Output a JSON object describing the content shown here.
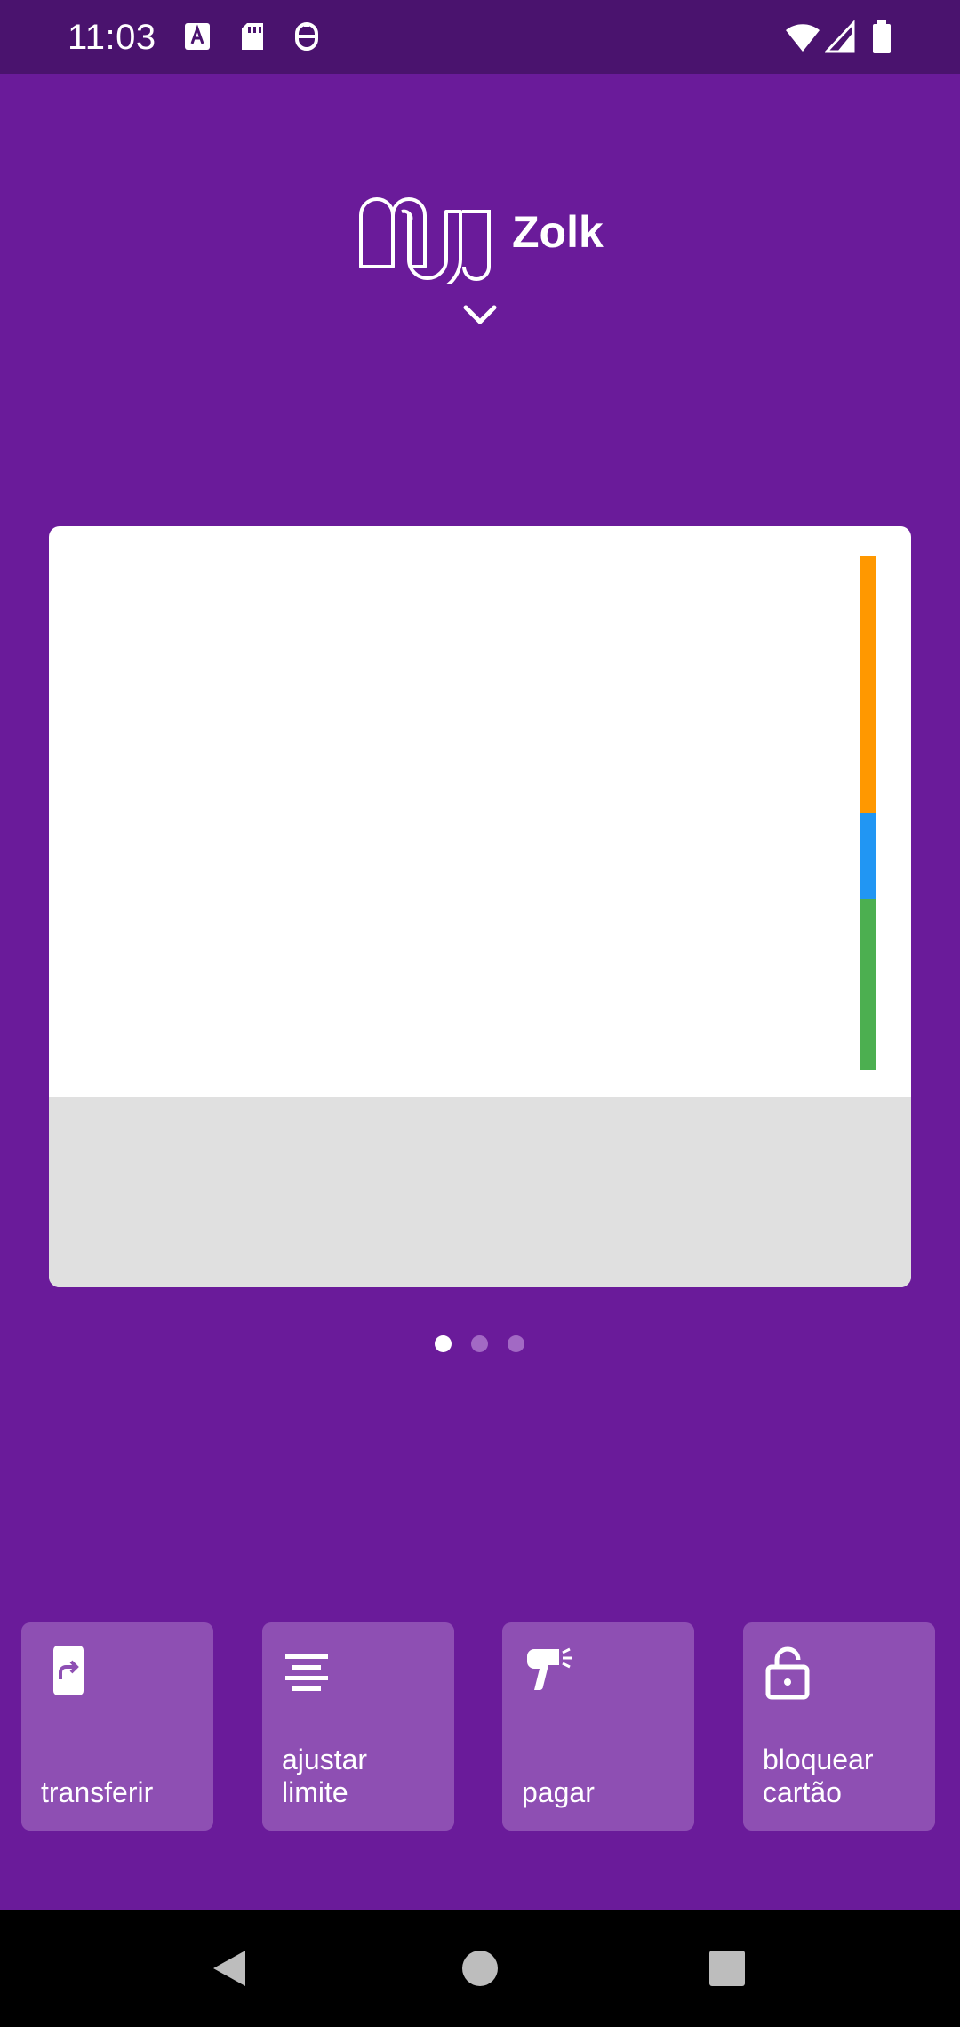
{
  "status_bar": {
    "time": "11:03",
    "left_icons": [
      "a-icon",
      "sd-card-icon",
      "vpn-icon"
    ],
    "right_icons": [
      "wifi-icon",
      "signal-icon",
      "battery-icon"
    ]
  },
  "header": {
    "logo": "nu-logo",
    "user_name": "Zolk",
    "expand_icon": "chevron-down-icon"
  },
  "card": {
    "indicator_bar": [
      {
        "color": "#FF9800",
        "share": 0.5
      },
      {
        "color": "#2196F3",
        "share": 0.167
      },
      {
        "color": "#4CAF50",
        "share": 0.333
      }
    ]
  },
  "pager": {
    "count": 3,
    "active": 0
  },
  "actions": [
    {
      "icon": "transfer-phone-icon",
      "label": "transferir"
    },
    {
      "icon": "adjust-limit-icon",
      "label": "ajustar\nlimite"
    },
    {
      "icon": "barcode-scanner-icon",
      "label": "pagar"
    },
    {
      "icon": "lock-icon",
      "label": "bloquear\ncartão"
    }
  ],
  "nav_bar": [
    "back-icon",
    "home-icon",
    "recents-icon"
  ],
  "colors": {
    "background": "#6A1B9A",
    "status_bar": "#4A136E",
    "tile": "#8E4FB3",
    "card_footer": "#E0E0E0"
  }
}
